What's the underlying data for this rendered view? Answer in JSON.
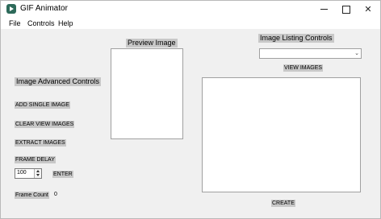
{
  "window": {
    "title": "GIF Animator",
    "accent": "#2d6a5a"
  },
  "title_controls": {
    "close_glyph": "✕"
  },
  "menu": [
    "File",
    "Controls",
    "Help"
  ],
  "left_panel": {
    "advanced_controls_label": "Image Advanced Controls",
    "add_single_image": "ADD SINGLE IMAGE",
    "clear_view_images": "CLEAR VIEW IMAGES",
    "extract_images": "EXTRACT IMAGES",
    "frame_delay_label": "FRAME DELAY",
    "frame_delay_value": "100",
    "enter": "ENTER",
    "frame_count_label": "Frame Count",
    "frame_count_value": "0"
  },
  "preview": {
    "label": "Preview Image"
  },
  "listing": {
    "label": "Image Listing Controls",
    "combo_arrow": "⌄",
    "view_images": "VIEW IMAGES",
    "create": "CREATE"
  }
}
